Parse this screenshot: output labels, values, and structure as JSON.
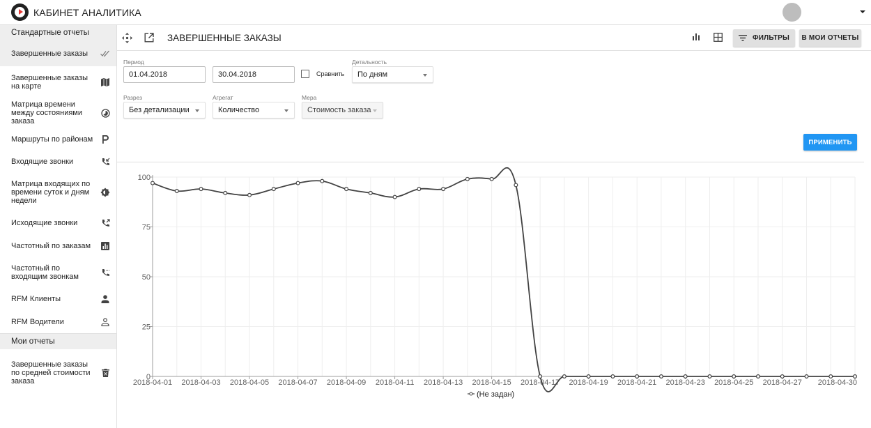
{
  "header": {
    "app_title": "КАБИНЕТ АНАЛИТИКА"
  },
  "sidebar": {
    "section_standard": "Стандартные отчеты",
    "items": [
      {
        "label": "Завершенные заказы",
        "icon": "double-check-icon"
      },
      {
        "label": "Завершенные заказы на карте",
        "icon": "map-icon"
      },
      {
        "label": "Матрица времени между состояниями заказа",
        "icon": "timelapse-icon"
      },
      {
        "label": "Маршруты по районам",
        "icon": "parking-icon"
      },
      {
        "label": "Входящие звонки",
        "icon": "phone-incoming-icon"
      },
      {
        "label": "Матрица входящих по времени суток и дням недели",
        "icon": "brightness-icon"
      },
      {
        "label": "Исходящие звонки",
        "icon": "phone-outgoing-icon"
      },
      {
        "label": "Частотный по заказам",
        "icon": "bar-chart-icon"
      },
      {
        "label": "Частотный по входящим звонкам",
        "icon": "phone-forwarded-icon"
      },
      {
        "label": "RFM Клиенты",
        "icon": "person-icon"
      },
      {
        "label": "RFM Водители",
        "icon": "person-outline-icon"
      }
    ],
    "section_my": "Мои отчеты",
    "my_items": [
      {
        "label": "Завершенные заказы по средней стоимости заказа",
        "icon": "delete-icon"
      }
    ]
  },
  "main": {
    "title": "ЗАВЕРШЕННЫЕ ЗАКАЗЫ",
    "filters_button": "ФИЛЬТРЫ",
    "my_reports_button": "В МОИ ОТЧЕТЫ",
    "apply_button": "ПРИМЕНИТЬ"
  },
  "form": {
    "period_label": "Период",
    "date_from": "01.04.2018",
    "date_to": "30.04.2018",
    "compare_label": "Сравнить",
    "compare_checked": false,
    "detail_label": "Детальность",
    "detail_value": "По дням",
    "slice_label": "Разрез",
    "slice_value": "Без детализации",
    "aggregate_label": "Агрегат",
    "aggregate_value": "Количество",
    "measure_label": "Мера",
    "measure_value": "Стоимость заказа"
  },
  "chart_data": {
    "type": "line",
    "x": [
      "2018-04-01",
      "2018-04-02",
      "2018-04-03",
      "2018-04-04",
      "2018-04-05",
      "2018-04-06",
      "2018-04-07",
      "2018-04-08",
      "2018-04-09",
      "2018-04-10",
      "2018-04-11",
      "2018-04-12",
      "2018-04-13",
      "2018-04-14",
      "2018-04-15",
      "2018-04-16",
      "2018-04-17",
      "2018-04-18",
      "2018-04-19",
      "2018-04-20",
      "2018-04-21",
      "2018-04-22",
      "2018-04-23",
      "2018-04-24",
      "2018-04-25",
      "2018-04-26",
      "2018-04-27",
      "2018-04-28",
      "2018-04-29",
      "2018-04-30"
    ],
    "series": [
      {
        "name": "(Не задан)",
        "values": [
          97,
          93,
          94,
          92,
          91,
          94,
          97,
          98,
          94,
          92,
          90,
          94,
          94,
          99,
          99,
          96,
          0,
          0,
          0,
          0,
          0,
          0,
          0,
          0,
          0,
          0,
          0,
          0,
          0,
          0
        ]
      }
    ],
    "ylim": [
      0,
      100
    ],
    "yticks": [
      0,
      25,
      50,
      75,
      100
    ],
    "xtick_labels": [
      "2018-04-01",
      "2018-04-03",
      "2018-04-05",
      "2018-04-07",
      "2018-04-09",
      "2018-04-11",
      "2018-04-13",
      "2018-04-15",
      "2018-04-17",
      "2018-04-19",
      "2018-04-21",
      "2018-04-23",
      "2018-04-25",
      "2018-04-27",
      "2018-04-30"
    ],
    "grid": true,
    "legend": "bottom",
    "line_color": "#424242"
  }
}
